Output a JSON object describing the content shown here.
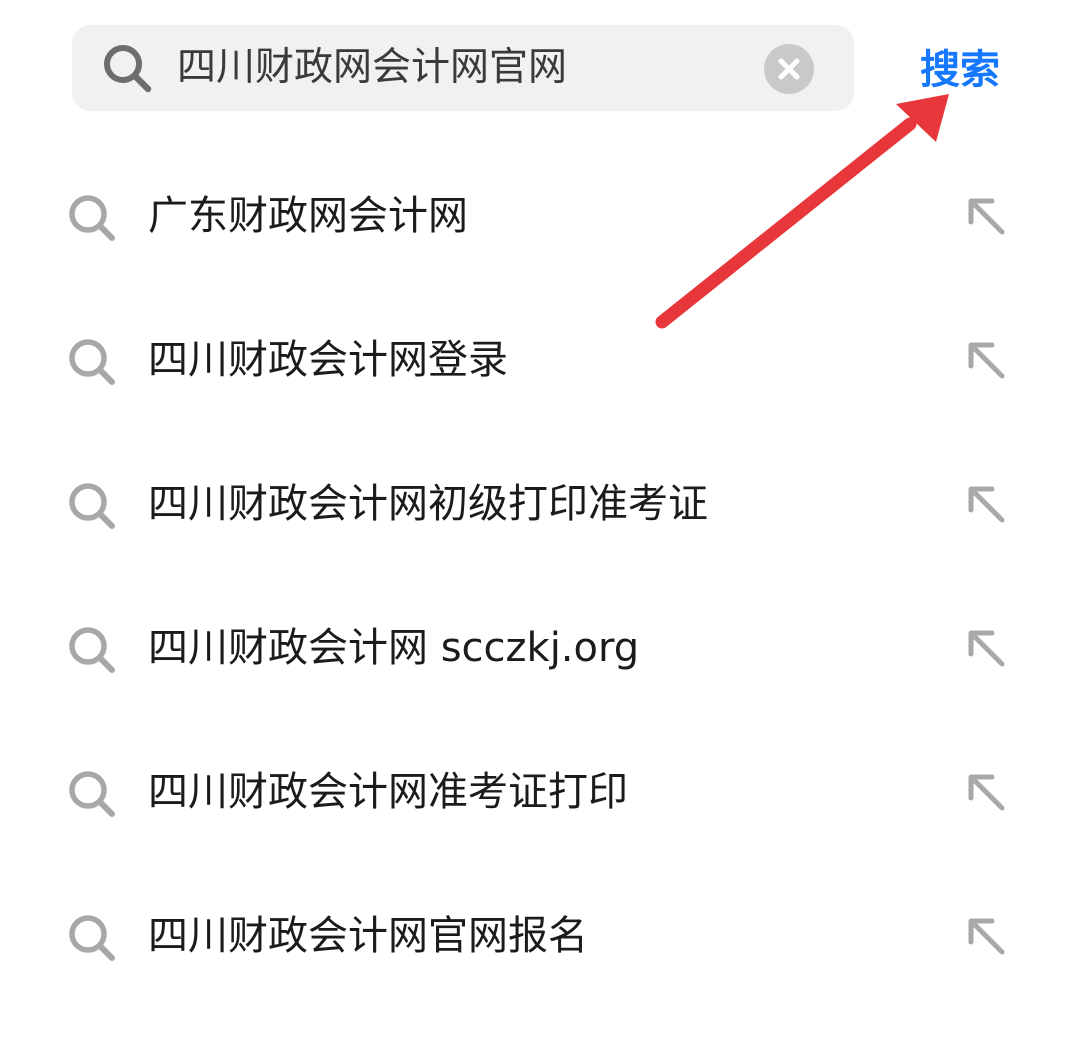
{
  "search": {
    "value": "四川财政网会计网官网",
    "button_label": "搜索"
  },
  "suggestions": [
    {
      "label": "广东财政网会计网"
    },
    {
      "label": "四川财政会计网登录"
    },
    {
      "label": "四川财政会计网初级打印准考证"
    },
    {
      "label": "四川财政会计网 scczkj.org"
    },
    {
      "label": "四川财政会计网准考证打印"
    },
    {
      "label": "四川财政会计网官网报名"
    }
  ],
  "icons": {
    "search": "search-icon",
    "clear": "close-icon",
    "fill": "arrow-up-left-icon",
    "annotation": "red-arrow-annotation"
  },
  "colors": {
    "accent": "#1677ff",
    "annotation_arrow": "#e8373a",
    "search_bg": "#f1f1f1",
    "icon_gray": "#a8a8a8"
  }
}
